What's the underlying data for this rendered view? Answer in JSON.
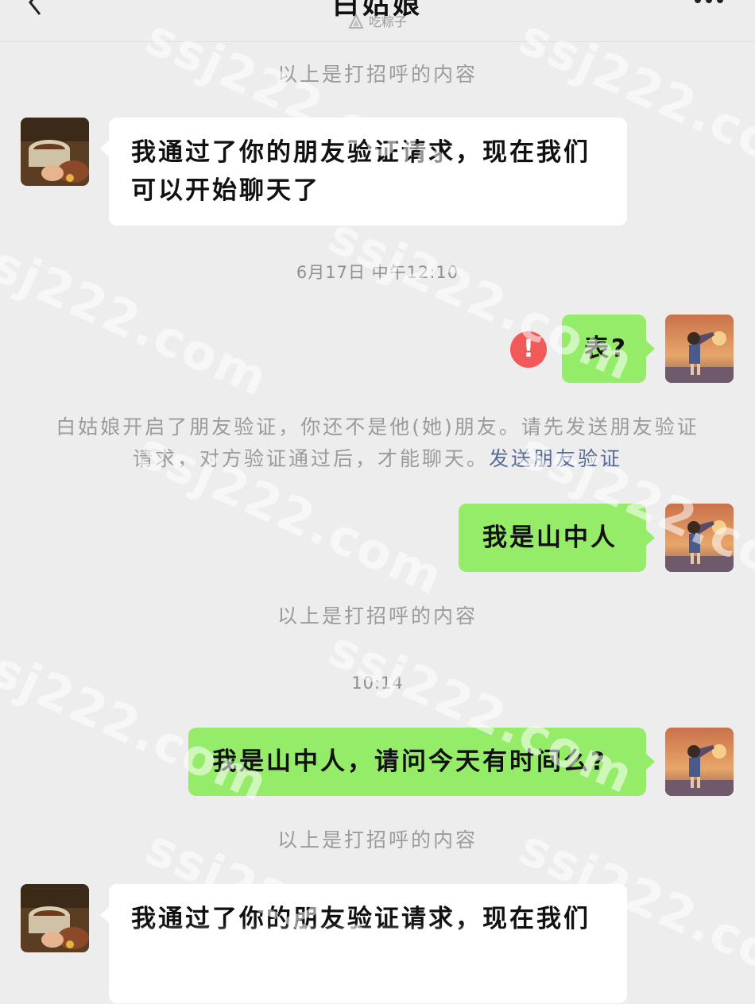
{
  "header": {
    "title": "白姑娘",
    "subtitle": "吃粽子"
  },
  "messages": {
    "sys1": "以上是打招呼的内容",
    "in1_text": "我通过了你的朋友验证请求，现在我们可以开始聊天了",
    "time1": "6月17日 中午12:10",
    "out1_text": "表?",
    "warn_glyph": "!",
    "verify_notice": "白姑娘开启了朋友验证，你还不是他(她)朋友。请先发送朋友验证请求，对方验证通过后，才能聊天。",
    "verify_link": "发送朋友验证",
    "out2_text": "我是山中人",
    "sys2": "以上是打招呼的内容",
    "time2": "10:14",
    "out3_text": "我是山中人，请问今天有时间么?",
    "sys3": "以上是打招呼的内容",
    "in2_text": "我通过了你的朋友验证请求，现在我们"
  },
  "watermark_text": "ssj222.com",
  "colors": {
    "background": "#ededed",
    "incoming_bubble": "#ffffff",
    "outgoing_bubble": "#95ec69",
    "warning": "#f25a5a",
    "link": "#576b95"
  }
}
